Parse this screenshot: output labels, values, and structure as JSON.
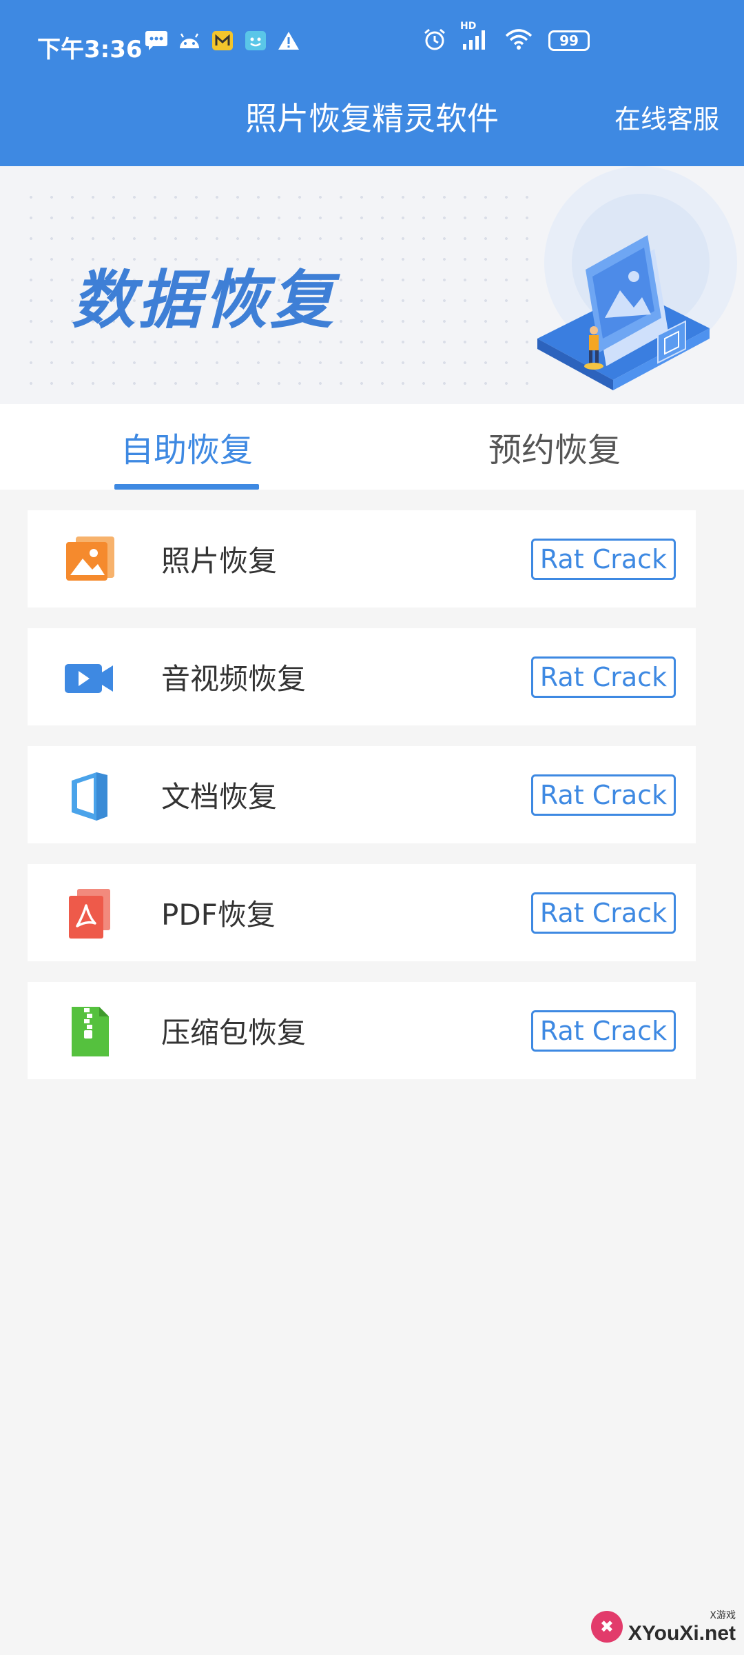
{
  "status_bar": {
    "time": "下午3:36",
    "battery": "99",
    "network": "HD",
    "left_icons": [
      "message-icon",
      "android-icon",
      "mail-icon",
      "face-icon",
      "warning-icon"
    ],
    "right_icons": [
      "alarm-icon",
      "signal-icon",
      "wifi-icon",
      "battery-icon"
    ]
  },
  "header": {
    "title": "照片恢复精灵软件",
    "service_link": "在线客服"
  },
  "banner": {
    "title": "数据恢复"
  },
  "tabs": [
    {
      "label": "自助恢复",
      "active": true
    },
    {
      "label": "预约恢复",
      "active": false
    }
  ],
  "items": [
    {
      "label": "照片恢复",
      "button": "Rat Crack",
      "icon": "photo-icon",
      "color": "#f58a2d"
    },
    {
      "label": "音视频恢复",
      "button": "Rat Crack",
      "icon": "video-icon",
      "color": "#3e89e2"
    },
    {
      "label": "文档恢复",
      "button": "Rat Crack",
      "icon": "document-icon",
      "color": "#4aa3ea"
    },
    {
      "label": "PDF恢复",
      "button": "Rat Crack",
      "icon": "pdf-icon",
      "color": "#ee5a4a"
    },
    {
      "label": "压缩包恢复",
      "button": "Rat Crack",
      "icon": "zip-icon",
      "color": "#55c13e"
    }
  ],
  "watermark": {
    "site": "XYouXi.net",
    "sub": "X游戏"
  },
  "colors": {
    "primary": "#3e89e2",
    "background": "#f5f5f5"
  }
}
